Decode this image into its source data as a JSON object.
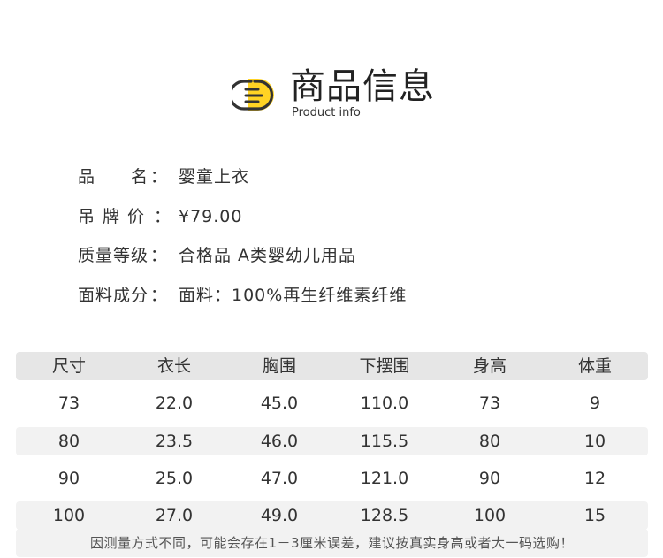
{
  "header": {
    "title": "商品信息",
    "subtitle": "Product info",
    "logo_icon": "document-lines-icon",
    "accent_color": "#FFD324",
    "ink_color": "#333333"
  },
  "info": [
    {
      "label": "品　　名",
      "colon": "：",
      "value": "婴童上衣"
    },
    {
      "label": "吊牌价",
      "colon": "：",
      "value": "¥79.00"
    },
    {
      "label": "质量等级",
      "colon": "：",
      "value": "合格品 A类婴幼儿用品"
    },
    {
      "label": "面料成分",
      "colon": "：",
      "value": "面料：100%再生纤维素纤维"
    }
  ],
  "size_table": {
    "headers": [
      "尺寸",
      "衣长",
      "胸围",
      "下摆围",
      "身高",
      "体重"
    ],
    "rows": [
      [
        "73",
        "22.0",
        "45.0",
        "110.0",
        "73",
        "9"
      ],
      [
        "80",
        "23.5",
        "46.0",
        "115.5",
        "80",
        "10"
      ],
      [
        "90",
        "25.0",
        "47.0",
        "121.0",
        "90",
        "12"
      ],
      [
        "100",
        "27.0",
        "49.0",
        "128.5",
        "100",
        "15"
      ]
    ],
    "header_bg": "#E6E6E6",
    "stripe_bg": "#F2F2F2"
  },
  "note": "因测量方式不同，可能会存在1－3厘米误差，建议按真实身高或者大一码选购！"
}
